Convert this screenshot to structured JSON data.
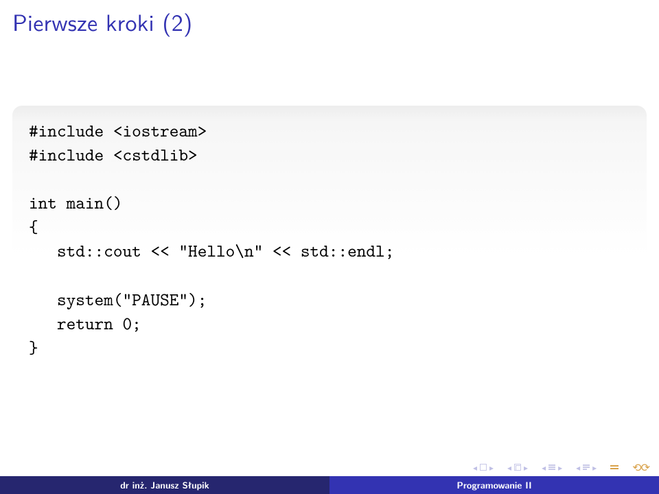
{
  "title": "Pierwsze kroki (2)",
  "code": {
    "l1": "#include <iostream>",
    "l2": "#include <cstdlib>",
    "l3": "",
    "l4": "int main()",
    "l5": "{",
    "l6": "   std::cout << \"Hello\\n\" << std::endl;",
    "l7": "",
    "l8": "   system(\"PAUSE\");",
    "l9": "   return 0;",
    "l10": "}"
  },
  "footer": {
    "author": "dr inż. Janusz Słupik",
    "course": "Programowanie II"
  }
}
